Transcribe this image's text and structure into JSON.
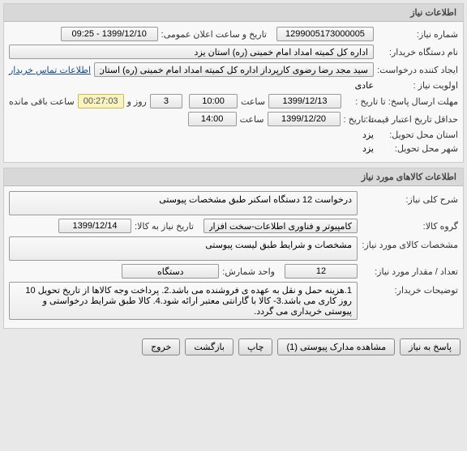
{
  "panel1": {
    "title": "اطلاعات نیاز",
    "need_no_label": "شماره نیاز:",
    "need_no": "1299005173000005",
    "announce_label": "تاریخ و ساعت اعلان عمومی:",
    "announce_dt": "1399/12/10 - 09:25",
    "buyer_org_label": "نام دستگاه خریدار:",
    "buyer_org": "اداره کل کمیته امداد امام خمینی (ره) استان یزد",
    "creator_label": "ایجاد کننده درخواست:",
    "creator": "سید مجد رضا رضوی کارپرداز اداره کل کمیته امداد امام خمینی (ره) استان یزد",
    "contact_link": "اطلاعات تماس خریدار",
    "priority_label": "اولویت نیاز :",
    "priority": "عادی",
    "deadline_reply_label": "مهلت ارسال پاسخ:  تا تاریخ :",
    "deadline_reply_date": "1399/12/13",
    "time_label": "ساعت",
    "deadline_reply_time": "10:00",
    "days": "3",
    "days_suffix": "روز و",
    "remaining": "00:27:03",
    "remaining_suffix": "ساعت باقی مانده",
    "credit_min_label": "حداقل تاریخ اعتبار قیمت:",
    "credit_to_label": "تا تاریخ :",
    "credit_date": "1399/12/20",
    "credit_time": "14:00",
    "delivery_province_label": "استان محل تحویل:",
    "delivery_province": "یزد",
    "delivery_city_label": "شهر محل تحویل:",
    "delivery_city": "یزد"
  },
  "panel2": {
    "title": "اطلاعات کالاهای مورد نیاز",
    "desc_label": "شرح کلی نیاز:",
    "desc": "درخواست 12 دستگاه اسکنر طبق مشخصات پیوستی",
    "group_label": "گروه کالا:",
    "group": "کامپیوتر و فناوری اطلاعات-سخت افزار",
    "need_date_label": "تاریخ نیاز به کالا:",
    "need_date": "1399/12/14",
    "spec_label": "مشخصات کالای مورد نیاز:",
    "spec": "مشخصات و شرایط طبق لیست پیوستی",
    "qty_label": "تعداد / مقدار مورد نیاز:",
    "qty": "12",
    "unit_label": "واحد شمارش:",
    "unit": "دستگاه",
    "notes_label": "توضیحات خریدار:",
    "notes": "1.هزینه حمل و نقل به عهده ی فروشنده می باشد.2. پرداخت وجه کالاها از تاریخ تحویل 10 روز کاری می باشد.3- کالا با گارانتی معتبر ارائه شود.4. کالا طبق شرایط درخواستی و پیوستی خریداری می گردد."
  },
  "buttons": {
    "respond": "پاسخ به نیاز",
    "view_attach": "مشاهده مدارک پیوستی  (1)",
    "print": "چاپ",
    "back": "بازگشت",
    "exit": "خروج"
  }
}
